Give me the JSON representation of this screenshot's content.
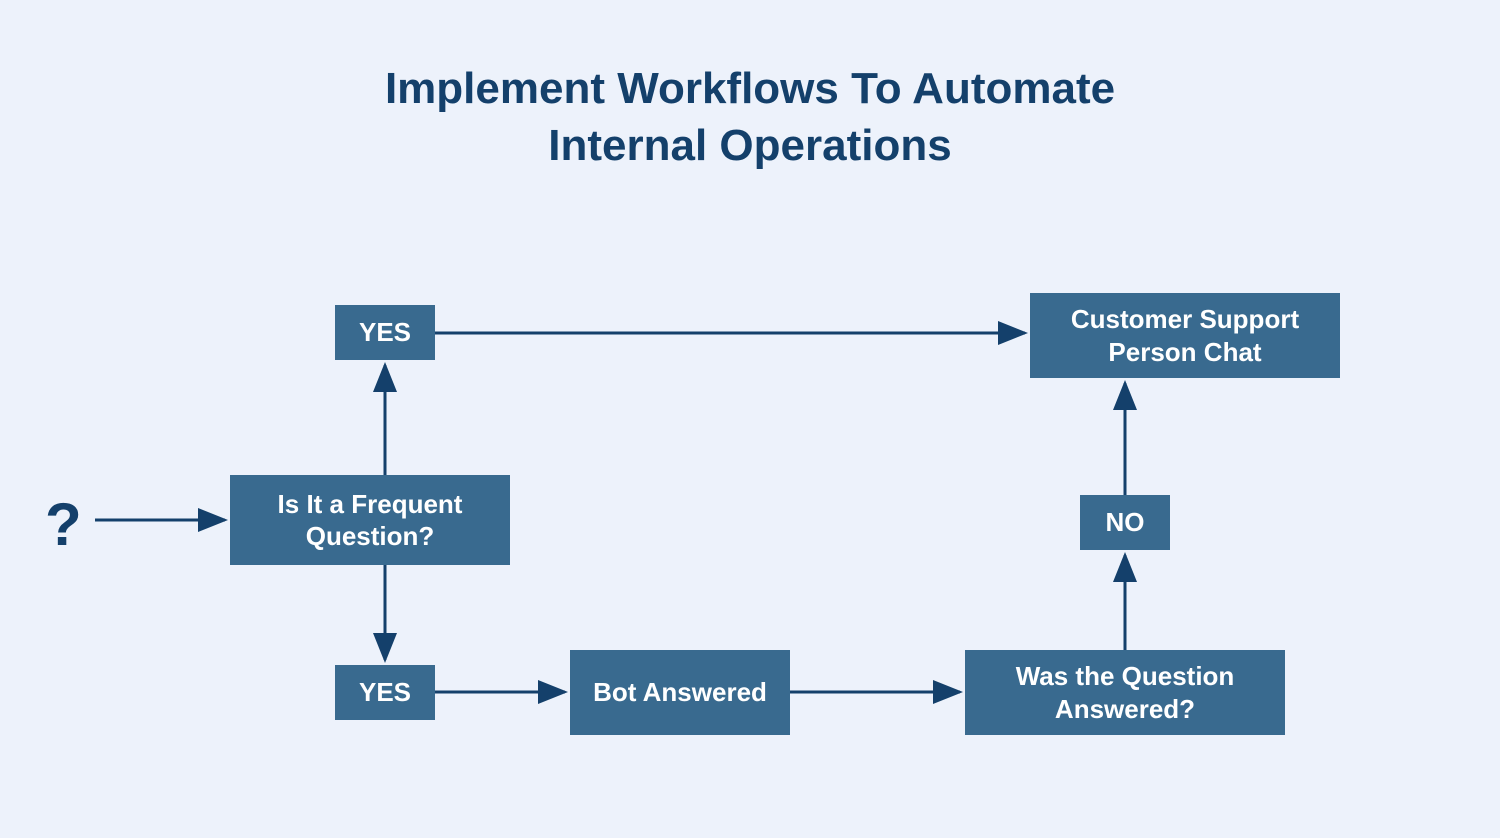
{
  "title_line1": "Implement Workflows To Automate",
  "title_line2": "Internal Operations",
  "start_symbol": "?",
  "nodes": {
    "frequent": "Is It a Frequent Question?",
    "yes_top": "YES",
    "yes_bottom": "YES",
    "bot_answered": "Bot Answered",
    "was_answered": "Was the Question Answered?",
    "no": "NO",
    "support": "Customer Support Person Chat"
  },
  "colors": {
    "bg": "#edf2fb",
    "node": "#396a8f",
    "text_dark": "#14406b",
    "text_light": "#ffffff",
    "arrow": "#14406b"
  }
}
